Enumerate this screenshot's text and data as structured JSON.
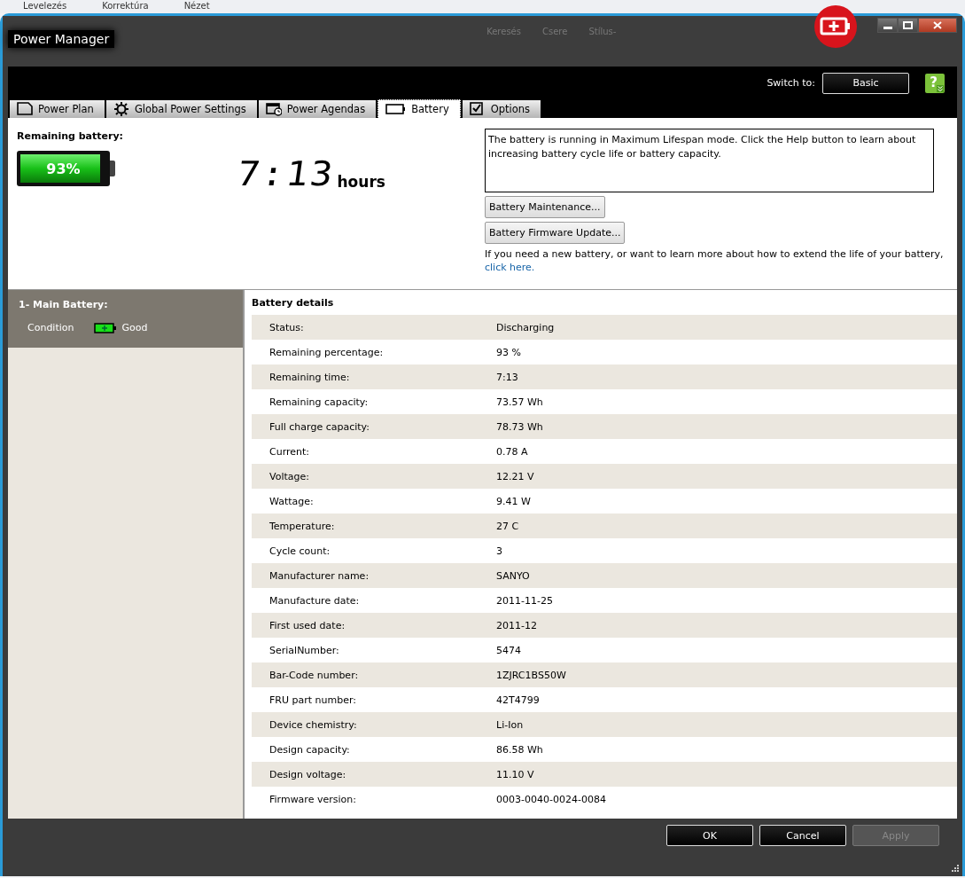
{
  "background_app": {
    "tabs": [
      "Levelezés",
      "Korrektúra",
      "Nézet"
    ],
    "commands": [
      "Keresés",
      "Csere",
      "Stílus-"
    ]
  },
  "window": {
    "title": "Power Manager"
  },
  "header": {
    "switch_label": "Switch to:",
    "switch_button": "Basic",
    "help": "?"
  },
  "tabs": [
    {
      "label": "Power Plan",
      "selected": false
    },
    {
      "label": "Global Power Settings",
      "selected": false
    },
    {
      "label": "Power Agendas",
      "selected": false
    },
    {
      "label": "Battery",
      "selected": true
    },
    {
      "label": "Options",
      "selected": false
    }
  ],
  "summary": {
    "label": "Remaining battery:",
    "percent": "93%",
    "level": 0.93,
    "time": "7:13",
    "time_unit": "hours",
    "message": "The battery is running in Maximum Lifespan mode. Click the Help button to learn about increasing battery cycle life or battery capacity.",
    "buttons": [
      "Battery Maintenance...",
      "Battery Firmware Update..."
    ],
    "note": "If you need a new battery, or want to learn more about how to extend the life of your battery,",
    "link": "click here."
  },
  "batteries": [
    {
      "name": "1- Main Battery:",
      "condition_label": "Condition",
      "condition": "Good",
      "selected": true
    }
  ],
  "details": {
    "title": "Battery details",
    "rows": [
      {
        "label": "Status:",
        "value": "Discharging"
      },
      {
        "label": "Remaining percentage:",
        "value": "93 %"
      },
      {
        "label": "Remaining time:",
        "value": "7:13"
      },
      {
        "label": "Remaining capacity:",
        "value": "73.57 Wh"
      },
      {
        "label": "Full charge capacity:",
        "value": "78.73 Wh"
      },
      {
        "label": "Current:",
        "value": "0.78 A"
      },
      {
        "label": "Voltage:",
        "value": "12.21 V"
      },
      {
        "label": "Wattage:",
        "value": "9.41 W"
      },
      {
        "label": "Temperature:",
        "value": "27 C"
      },
      {
        "label": "Cycle count:",
        "value": "3"
      },
      {
        "label": "Manufacturer name:",
        "value": "SANYO"
      },
      {
        "label": "Manufacture date:",
        "value": "2011-11-25"
      },
      {
        "label": "First used date:",
        "value": "2011-12"
      },
      {
        "label": "SerialNumber:",
        "value": "5474"
      },
      {
        "label": "Bar-Code number:",
        "value": "1ZJRC1BS50W"
      },
      {
        "label": "FRU part number:",
        "value": "42T4799"
      },
      {
        "label": "Device chemistry:",
        "value": "Li-Ion"
      },
      {
        "label": "Design capacity:",
        "value": "86.58 Wh"
      },
      {
        "label": "Design voltage:",
        "value": "11.10 V"
      },
      {
        "label": "Firmware version:",
        "value": "0003-0040-0024-0084"
      }
    ]
  },
  "footer_buttons": [
    {
      "label": "OK",
      "disabled": false
    },
    {
      "label": "Cancel",
      "disabled": false
    },
    {
      "label": "Apply",
      "disabled": true
    }
  ]
}
